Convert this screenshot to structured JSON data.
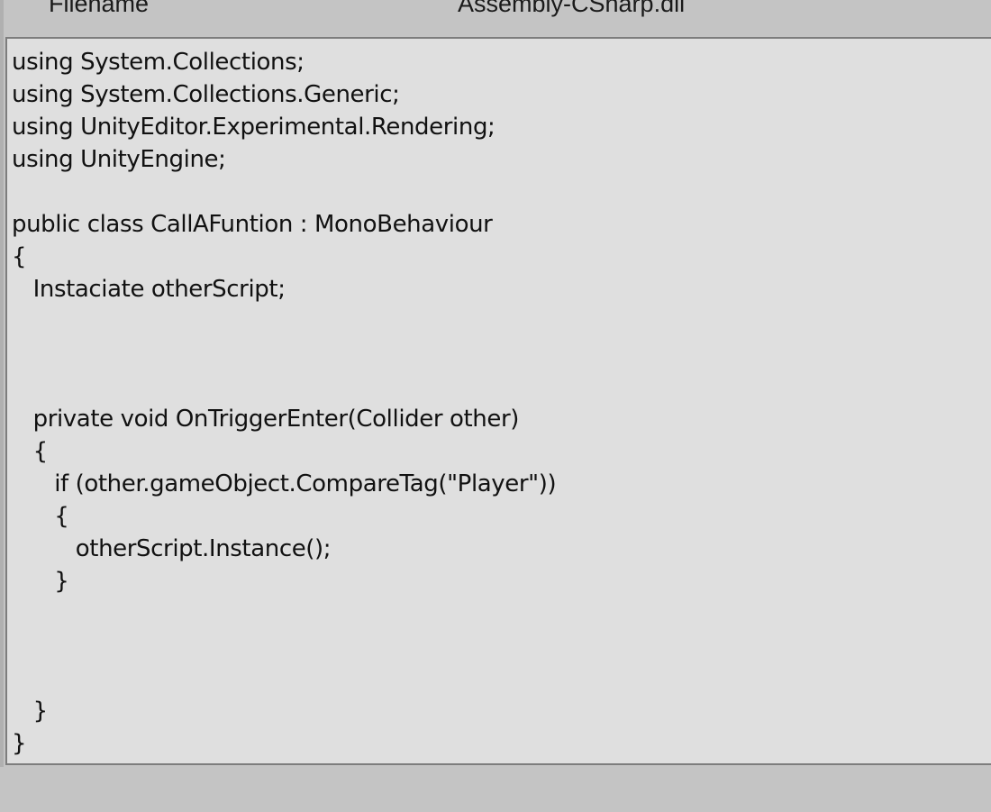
{
  "header": {
    "label": "Filename",
    "value": "Assembly-CSharp.dll"
  },
  "code": {
    "lines": [
      "using System.Collections;",
      "using System.Collections.Generic;",
      "using UnityEditor.Experimental.Rendering;",
      "using UnityEngine;",
      "",
      "public class CallAFuntion : MonoBehaviour",
      "{",
      "   Instaciate otherScript;",
      "",
      "",
      "",
      "   private void OnTriggerEnter(Collider other)",
      "   {",
      "      if (other.gameObject.CompareTag(\"Player\"))",
      "      {",
      "         otherScript.Instance();",
      "      }",
      "",
      "",
      "",
      "   }",
      "}"
    ]
  }
}
